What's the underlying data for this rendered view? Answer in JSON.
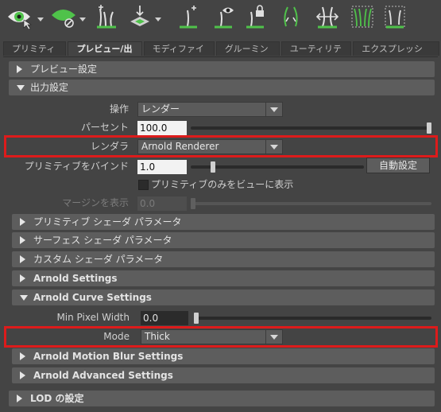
{
  "toolbar": {
    "tools": [
      {
        "icon": "eye-cursor-icon",
        "has_menu": true
      },
      {
        "icon": "leaf-disabled-icon",
        "has_menu": true
      },
      {
        "icon": "add-grass-guides-icon",
        "has_menu": false
      },
      {
        "icon": "transform-guides-icon",
        "has_menu": true
      },
      {
        "icon": "add-guide-icon",
        "has_menu": false
      },
      {
        "icon": "guide-visibility-icon",
        "has_menu": false
      },
      {
        "icon": "lock-guide-icon",
        "has_menu": false
      },
      {
        "icon": "curve-guides-icon",
        "has_menu": false
      },
      {
        "icon": "cut-guides-icon",
        "has_menu": false
      },
      {
        "icon": "grass-bundle-icon",
        "has_menu": false
      },
      {
        "icon": "select-guides-icon",
        "has_menu": false
      }
    ]
  },
  "tabs": [
    {
      "label": "プリミティブ",
      "active": false
    },
    {
      "label": "プレビュー/出力",
      "active": true
    },
    {
      "label": "モディファイア",
      "active": false
    },
    {
      "label": "グルーミング",
      "active": false
    },
    {
      "label": "ユーティリティ",
      "active": false
    },
    {
      "label": "エクスプレッション",
      "active": false
    }
  ],
  "sections": {
    "preview_settings": "プレビュー設定",
    "output_settings": "出力設定",
    "primitive_shader": "プリミティブ シェーダ パラメータ",
    "surface_shader": "サーフェス シェーダ パラメータ",
    "custom_shader": "カスタム シェーダ パラメータ",
    "arnold_settings": "Arnold Settings",
    "arnold_curve_settings": "Arnold Curve Settings",
    "arnold_motion_blur": "Arnold Motion Blur Settings",
    "arnold_advanced": "Arnold Advanced Settings",
    "lod": "LOD の設定"
  },
  "output": {
    "operation_label": "操作",
    "operation_value": "レンダー",
    "percent_label": "パーセント",
    "percent_value": "100.0",
    "percent_fraction": 1.0,
    "renderer_label": "レンダラ",
    "renderer_value": "Arnold Renderer",
    "bind_label": "プリミティブをバインド",
    "bind_value": "1.0",
    "bind_fraction": 0.12,
    "auto_button": "自動設定",
    "checkbox_label": "プリミティブのみをビューに表示",
    "checkbox_checked": false,
    "margin_label": "マージンを表示",
    "margin_value": "0.0"
  },
  "curve": {
    "min_pixel_label": "Min Pixel Width",
    "min_pixel_value": "0.0",
    "mode_label": "Mode",
    "mode_value": "Thick"
  },
  "colors": {
    "highlight": "#dd1b1b",
    "leaf_green": "#4fc24a"
  }
}
